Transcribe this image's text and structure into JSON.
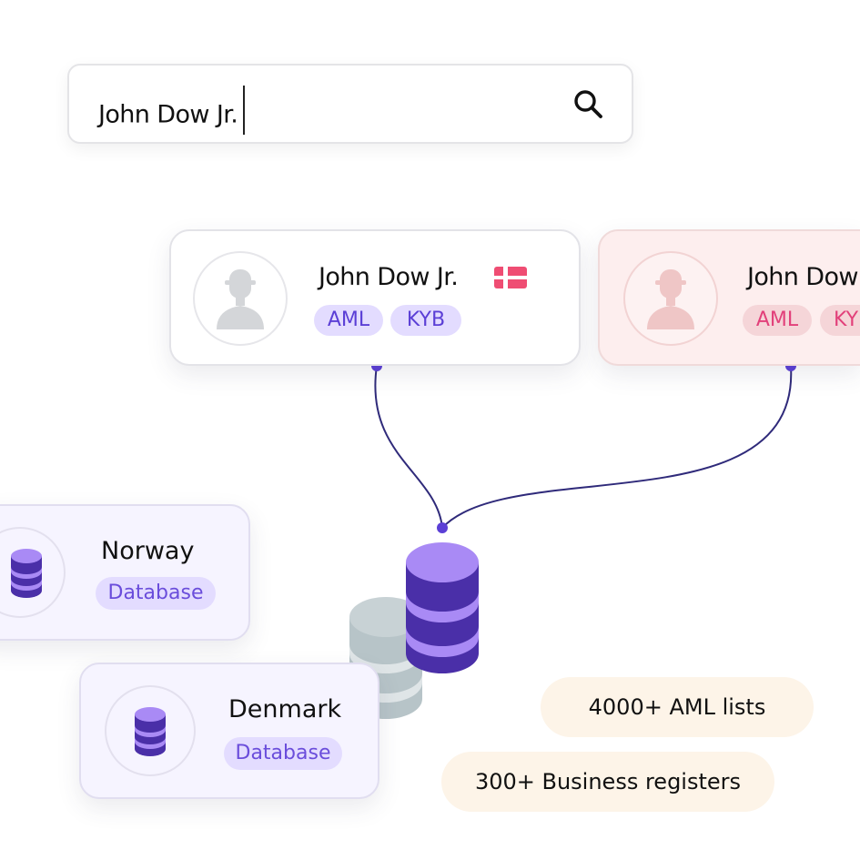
{
  "search": {
    "value": "John Dow Jr.",
    "icon": "search-icon"
  },
  "results": [
    {
      "name": "John Dow Jr.",
      "flag": "denmark-flag-icon",
      "tags": [
        "AML",
        "KYB"
      ]
    },
    {
      "name": "John Dow",
      "tags": [
        "AML",
        "KY"
      ]
    }
  ],
  "databases": [
    {
      "name": "Norway",
      "tag": "Database"
    },
    {
      "name": "Denmark",
      "tag": "Database"
    }
  ],
  "stats": {
    "aml_lists": "4000+ AML lists",
    "business_registers": "300+ Business registers"
  },
  "colors": {
    "accent": "#5b3fd6",
    "connector": "#2f2a7a",
    "db_purple_top": "#a98af5",
    "db_purple_body": "#4a2fa8",
    "db_gray": "#b7c4c8",
    "flag_red": "#ef4d73",
    "pink_tag_text": "#e2407a"
  }
}
